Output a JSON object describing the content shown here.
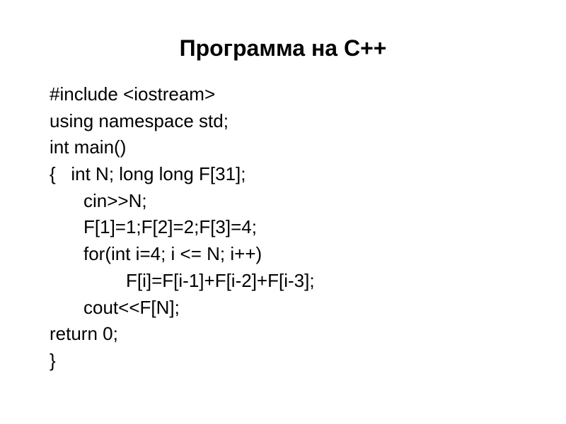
{
  "title": "Программа на С++",
  "code": {
    "line1": "#include <iostream>",
    "line2": "using namespace std;",
    "line3": "int main()",
    "line4": "{   int N; long long F[31];",
    "line5": "cin>>N;",
    "line6": "F[1]=1;F[2]=2;F[3]=4;",
    "line7": "for(int i=4; i <= N; i++)",
    "line8": "F[i]=F[i-1]+F[i-2]+F[i-3];",
    "line9": "cout<<F[N];",
    "line10": "return 0;",
    "line11": "}"
  }
}
